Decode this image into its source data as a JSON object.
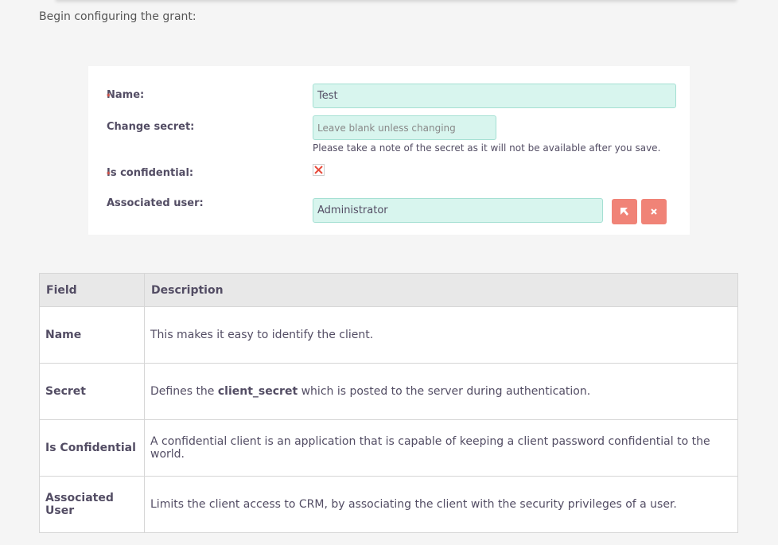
{
  "intro": "Begin configuring the grant:",
  "form": {
    "name_label": "Name:",
    "name_value": "Test",
    "secret_label": "Change secret:",
    "secret_placeholder": "Leave blank unless changing",
    "secret_help": "Please take a note of the secret as it will not be available after you save.",
    "confidential_label": "Is confidential:",
    "confidential_checked": false,
    "user_label": "Associated user:",
    "user_value": "Administrator",
    "required_marker": "*"
  },
  "table": {
    "headers": [
      "Field",
      "Description"
    ],
    "rows": [
      {
        "field": "Name",
        "desc": "This makes it easy to identify the client."
      },
      {
        "field": "Secret",
        "desc_before": "Defines the ",
        "desc_bold": "client_secret",
        "desc_after": " which is posted to the server during authentication."
      },
      {
        "field": "Is Confidential",
        "desc": "A confidential client is an application that is capable of keeping a client password confidential to the world."
      },
      {
        "field": "Associated User",
        "desc": "Limits the client access to CRM, by associating the client with the security privileges of a user."
      }
    ]
  },
  "colors": {
    "accent_button": "#f08377",
    "input_bg": "#d8f5ee",
    "checkbox_x": "#e74c3c"
  },
  "icons": {
    "select_button": "arrow-select-icon",
    "clear_button": "close-icon",
    "checkbox": "x-mark-icon"
  }
}
